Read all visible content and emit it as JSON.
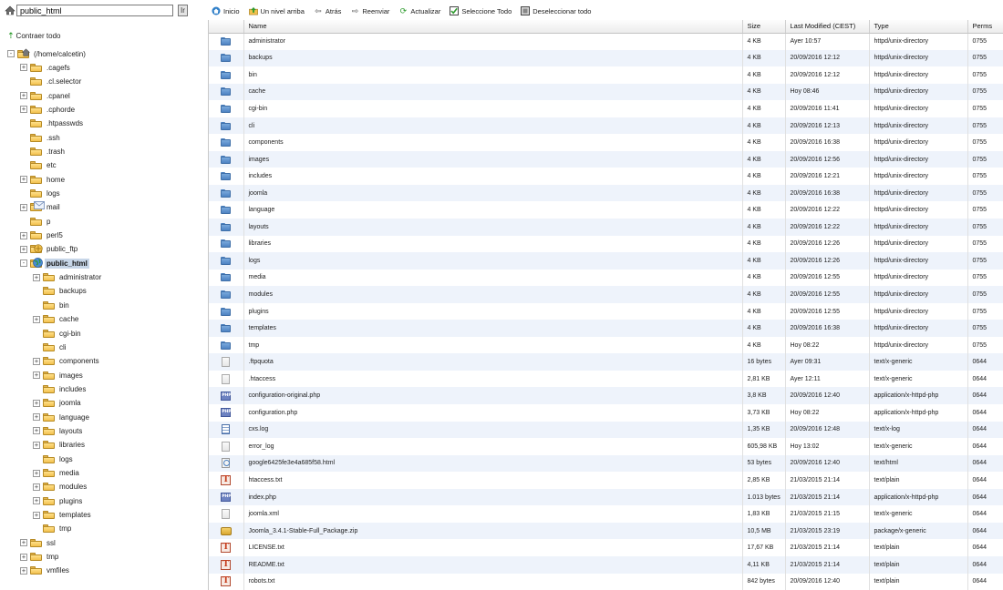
{
  "left_panel": {
    "path_input": "public_html",
    "go_label": "Ir",
    "collapse_all_label": "Contraer todo",
    "tree": [
      {
        "label": "(/home/calcetin)",
        "depth": 0,
        "expander": "-",
        "icon": "home-folder-icon",
        "selected": false
      },
      {
        "label": ".cagefs",
        "depth": 1,
        "expander": "+",
        "icon": "folder-icon",
        "selected": false
      },
      {
        "label": ".cl.selector",
        "depth": 1,
        "expander": "",
        "icon": "folder-icon",
        "selected": false
      },
      {
        "label": ".cpanel",
        "depth": 1,
        "expander": "+",
        "icon": "folder-icon",
        "selected": false
      },
      {
        "label": ".cphorde",
        "depth": 1,
        "expander": "+",
        "icon": "folder-icon",
        "selected": false
      },
      {
        "label": ".htpasswds",
        "depth": 1,
        "expander": "",
        "icon": "folder-icon",
        "selected": false
      },
      {
        "label": ".ssh",
        "depth": 1,
        "expander": "",
        "icon": "folder-icon",
        "selected": false
      },
      {
        "label": ".trash",
        "depth": 1,
        "expander": "",
        "icon": "folder-icon",
        "selected": false
      },
      {
        "label": "etc",
        "depth": 1,
        "expander": "",
        "icon": "folder-icon",
        "selected": false
      },
      {
        "label": "home",
        "depth": 1,
        "expander": "+",
        "icon": "folder-icon",
        "selected": false
      },
      {
        "label": "logs",
        "depth": 1,
        "expander": "",
        "icon": "folder-icon",
        "selected": false
      },
      {
        "label": "mail",
        "depth": 1,
        "expander": "+",
        "icon": "mail-folder-icon",
        "selected": false
      },
      {
        "label": "p",
        "depth": 1,
        "expander": "",
        "icon": "folder-icon",
        "selected": false
      },
      {
        "label": "perl5",
        "depth": 1,
        "expander": "+",
        "icon": "folder-icon",
        "selected": false
      },
      {
        "label": "public_ftp",
        "depth": 1,
        "expander": "+",
        "icon": "ftp-folder-icon",
        "selected": false
      },
      {
        "label": "public_html",
        "depth": 1,
        "expander": "-",
        "icon": "globe-folder-icon",
        "selected": true
      },
      {
        "label": "administrator",
        "depth": 2,
        "expander": "+",
        "icon": "folder-icon",
        "selected": false
      },
      {
        "label": "backups",
        "depth": 2,
        "expander": "",
        "icon": "folder-icon",
        "selected": false
      },
      {
        "label": "bin",
        "depth": 2,
        "expander": "",
        "icon": "folder-icon",
        "selected": false
      },
      {
        "label": "cache",
        "depth": 2,
        "expander": "+",
        "icon": "folder-icon",
        "selected": false
      },
      {
        "label": "cgi-bin",
        "depth": 2,
        "expander": "",
        "icon": "folder-icon",
        "selected": false
      },
      {
        "label": "cli",
        "depth": 2,
        "expander": "",
        "icon": "folder-icon",
        "selected": false
      },
      {
        "label": "components",
        "depth": 2,
        "expander": "+",
        "icon": "folder-icon",
        "selected": false
      },
      {
        "label": "images",
        "depth": 2,
        "expander": "+",
        "icon": "folder-icon",
        "selected": false
      },
      {
        "label": "includes",
        "depth": 2,
        "expander": "",
        "icon": "folder-icon",
        "selected": false
      },
      {
        "label": "joomla",
        "depth": 2,
        "expander": "+",
        "icon": "folder-icon",
        "selected": false
      },
      {
        "label": "language",
        "depth": 2,
        "expander": "+",
        "icon": "folder-icon",
        "selected": false
      },
      {
        "label": "layouts",
        "depth": 2,
        "expander": "+",
        "icon": "folder-icon",
        "selected": false
      },
      {
        "label": "libraries",
        "depth": 2,
        "expander": "+",
        "icon": "folder-icon",
        "selected": false
      },
      {
        "label": "logs",
        "depth": 2,
        "expander": "",
        "icon": "folder-icon",
        "selected": false
      },
      {
        "label": "media",
        "depth": 2,
        "expander": "+",
        "icon": "folder-icon",
        "selected": false
      },
      {
        "label": "modules",
        "depth": 2,
        "expander": "+",
        "icon": "folder-icon",
        "selected": false
      },
      {
        "label": "plugins",
        "depth": 2,
        "expander": "+",
        "icon": "folder-icon",
        "selected": false
      },
      {
        "label": "templates",
        "depth": 2,
        "expander": "+",
        "icon": "folder-icon",
        "selected": false
      },
      {
        "label": "tmp",
        "depth": 2,
        "expander": "",
        "icon": "folder-icon",
        "selected": false
      },
      {
        "label": "ssl",
        "depth": 1,
        "expander": "+",
        "icon": "folder-icon",
        "selected": false
      },
      {
        "label": "tmp",
        "depth": 1,
        "expander": "+",
        "icon": "folder-icon",
        "selected": false
      },
      {
        "label": "vmfiles",
        "depth": 1,
        "expander": "+",
        "icon": "folder-icon",
        "selected": false
      }
    ]
  },
  "toolbar": {
    "buttons": [
      {
        "label": "Inicio",
        "icon": "home-icon"
      },
      {
        "label": "Un nivel arriba",
        "icon": "up-level-icon"
      },
      {
        "label": "Atrás",
        "icon": "back-icon"
      },
      {
        "label": "Reenviar",
        "icon": "forward-icon"
      },
      {
        "label": "Actualizar",
        "icon": "refresh-icon"
      },
      {
        "label": "Seleccione Todo",
        "icon": "select-all-icon"
      },
      {
        "label": "Deseleccionar todo",
        "icon": "deselect-all-icon"
      }
    ]
  },
  "table": {
    "columns": [
      "",
      "Name",
      "Size",
      "Last Modified (CEST)",
      "Type",
      "Perms"
    ],
    "rows": [
      {
        "icon": "folder-icon",
        "name": "administrator",
        "size": "4 KB",
        "modified": "Ayer 10:57",
        "type": "httpd/unix-directory",
        "perms": "0755"
      },
      {
        "icon": "folder-icon",
        "name": "backups",
        "size": "4 KB",
        "modified": "20/09/2016 12:12",
        "type": "httpd/unix-directory",
        "perms": "0755"
      },
      {
        "icon": "folder-icon",
        "name": "bin",
        "size": "4 KB",
        "modified": "20/09/2016 12:12",
        "type": "httpd/unix-directory",
        "perms": "0755"
      },
      {
        "icon": "folder-icon",
        "name": "cache",
        "size": "4 KB",
        "modified": "Hoy 08:46",
        "type": "httpd/unix-directory",
        "perms": "0755"
      },
      {
        "icon": "folder-icon",
        "name": "cgi-bin",
        "size": "4 KB",
        "modified": "20/09/2016 11:41",
        "type": "httpd/unix-directory",
        "perms": "0755"
      },
      {
        "icon": "folder-icon",
        "name": "cli",
        "size": "4 KB",
        "modified": "20/09/2016 12:13",
        "type": "httpd/unix-directory",
        "perms": "0755"
      },
      {
        "icon": "folder-icon",
        "name": "components",
        "size": "4 KB",
        "modified": "20/09/2016 16:38",
        "type": "httpd/unix-directory",
        "perms": "0755"
      },
      {
        "icon": "folder-icon",
        "name": "images",
        "size": "4 KB",
        "modified": "20/09/2016 12:56",
        "type": "httpd/unix-directory",
        "perms": "0755"
      },
      {
        "icon": "folder-icon",
        "name": "includes",
        "size": "4 KB",
        "modified": "20/09/2016 12:21",
        "type": "httpd/unix-directory",
        "perms": "0755"
      },
      {
        "icon": "folder-icon",
        "name": "joomla",
        "size": "4 KB",
        "modified": "20/09/2016 16:38",
        "type": "httpd/unix-directory",
        "perms": "0755"
      },
      {
        "icon": "folder-icon",
        "name": "language",
        "size": "4 KB",
        "modified": "20/09/2016 12:22",
        "type": "httpd/unix-directory",
        "perms": "0755"
      },
      {
        "icon": "folder-icon",
        "name": "layouts",
        "size": "4 KB",
        "modified": "20/09/2016 12:22",
        "type": "httpd/unix-directory",
        "perms": "0755"
      },
      {
        "icon": "folder-icon",
        "name": "libraries",
        "size": "4 KB",
        "modified": "20/09/2016 12:26",
        "type": "httpd/unix-directory",
        "perms": "0755"
      },
      {
        "icon": "folder-icon",
        "name": "logs",
        "size": "4 KB",
        "modified": "20/09/2016 12:26",
        "type": "httpd/unix-directory",
        "perms": "0755"
      },
      {
        "icon": "folder-icon",
        "name": "media",
        "size": "4 KB",
        "modified": "20/09/2016 12:55",
        "type": "httpd/unix-directory",
        "perms": "0755"
      },
      {
        "icon": "folder-icon",
        "name": "modules",
        "size": "4 KB",
        "modified": "20/09/2016 12:55",
        "type": "httpd/unix-directory",
        "perms": "0755"
      },
      {
        "icon": "folder-icon",
        "name": "plugins",
        "size": "4 KB",
        "modified": "20/09/2016 12:55",
        "type": "httpd/unix-directory",
        "perms": "0755"
      },
      {
        "icon": "folder-icon",
        "name": "templates",
        "size": "4 KB",
        "modified": "20/09/2016 16:38",
        "type": "httpd/unix-directory",
        "perms": "0755"
      },
      {
        "icon": "folder-icon",
        "name": "tmp",
        "size": "4 KB",
        "modified": "Hoy 08:22",
        "type": "httpd/unix-directory",
        "perms": "0755"
      },
      {
        "icon": "generic-file-icon",
        "name": ".ftpquota",
        "size": "16 bytes",
        "modified": "Ayer 09:31",
        "type": "text/x-generic",
        "perms": "0644"
      },
      {
        "icon": "generic-file-icon",
        "name": ".htaccess",
        "size": "2,81 KB",
        "modified": "Ayer 12:11",
        "type": "text/x-generic",
        "perms": "0644"
      },
      {
        "icon": "php-file-icon",
        "name": "configuration-original.php",
        "size": "3,8 KB",
        "modified": "20/09/2016 12:40",
        "type": "application/x-httpd-php",
        "perms": "0644"
      },
      {
        "icon": "php-file-icon",
        "name": "configuration.php",
        "size": "3,73 KB",
        "modified": "Hoy 08:22",
        "type": "application/x-httpd-php",
        "perms": "0644"
      },
      {
        "icon": "log-file-icon",
        "name": "cxs.log",
        "size": "1,35 KB",
        "modified": "20/09/2016 12:48",
        "type": "text/x-log",
        "perms": "0644"
      },
      {
        "icon": "generic-file-icon",
        "name": "error_log",
        "size": "605,98 KB",
        "modified": "Hoy 13:02",
        "type": "text/x-generic",
        "perms": "0644"
      },
      {
        "icon": "html-file-icon",
        "name": "google6425fe3e4a685f58.html",
        "size": "53 bytes",
        "modified": "20/09/2016 12:40",
        "type": "text/html",
        "perms": "0644"
      },
      {
        "icon": "text-file-icon",
        "name": "htaccess.txt",
        "size": "2,85 KB",
        "modified": "21/03/2015 21:14",
        "type": "text/plain",
        "perms": "0644"
      },
      {
        "icon": "php-file-icon",
        "name": "index.php",
        "size": "1.013 bytes",
        "modified": "21/03/2015 21:14",
        "type": "application/x-httpd-php",
        "perms": "0644"
      },
      {
        "icon": "generic-file-icon",
        "name": "joomla.xml",
        "size": "1,83 KB",
        "modified": "21/03/2015 21:15",
        "type": "text/x-generic",
        "perms": "0644"
      },
      {
        "icon": "zip-file-icon",
        "name": "Joomla_3.4.1-Stable-Full_Package.zip",
        "size": "10,5 MB",
        "modified": "21/03/2015 23:19",
        "type": "package/x-generic",
        "perms": "0644"
      },
      {
        "icon": "text-file-icon",
        "name": "LICENSE.txt",
        "size": "17,67 KB",
        "modified": "21/03/2015 21:14",
        "type": "text/plain",
        "perms": "0644"
      },
      {
        "icon": "text-file-icon",
        "name": "README.txt",
        "size": "4,11 KB",
        "modified": "21/03/2015 21:14",
        "type": "text/plain",
        "perms": "0644"
      },
      {
        "icon": "text-file-icon",
        "name": "robots.txt",
        "size": "842 bytes",
        "modified": "20/09/2016 12:40",
        "type": "text/plain",
        "perms": "0644"
      }
    ]
  },
  "colors": {
    "folder_yellow": "#f2c14e",
    "folder_blue": "#4e83c3",
    "row_alt": "#eef3fb",
    "selected_tree": "#c7d6e8"
  }
}
